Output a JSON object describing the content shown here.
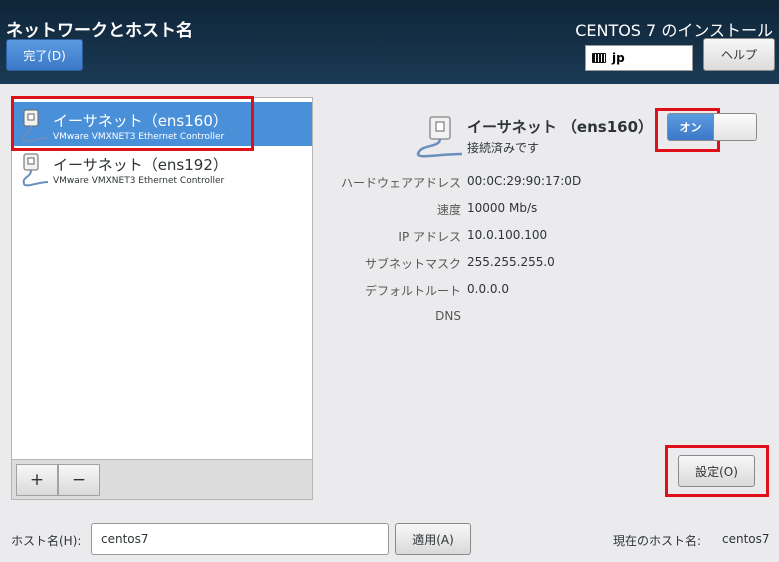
{
  "header": {
    "page_title": "ネットワークとホスト名",
    "install_title": "CENTOS 7 のインストール",
    "done_label": "完了(D)",
    "keyboard_layout": "jp",
    "help_label": "ヘルプ"
  },
  "devices": [
    {
      "name": "イーサネット（ens160）",
      "description": "VMware VMXNET3 Ethernet Controller",
      "selected": true
    },
    {
      "name": "イーサネット（ens192）",
      "description": "VMware VMXNET3 Ethernet Controller",
      "selected": false
    }
  ],
  "list_toolbar": {
    "add_label": "+",
    "remove_label": "−"
  },
  "detail": {
    "name": "イーサネット （ens160）",
    "status": "接続済みです",
    "toggle_label": "オン",
    "properties": [
      {
        "label": "ハードウェアアドレス",
        "value": "00:0C:29:90:17:0D"
      },
      {
        "label": "速度",
        "value": "10000 Mb/s"
      },
      {
        "label": "IP アドレス",
        "value": "10.0.100.100"
      },
      {
        "label": "サブネットマスク",
        "value": "255.255.255.0"
      },
      {
        "label": "デフォルトルート",
        "value": "0.0.0.0"
      },
      {
        "label": "DNS",
        "value": ""
      }
    ],
    "settings_label": "設定(O)"
  },
  "hostname": {
    "label": "ホスト名(H):",
    "value": "centos7",
    "apply_label": "適用(A)",
    "current_label": "現在のホスト名:",
    "current_value": "centos7"
  },
  "colors": {
    "accent": "#4a90d9",
    "highlight": "#e0101b",
    "header_bg": "#132c42"
  }
}
